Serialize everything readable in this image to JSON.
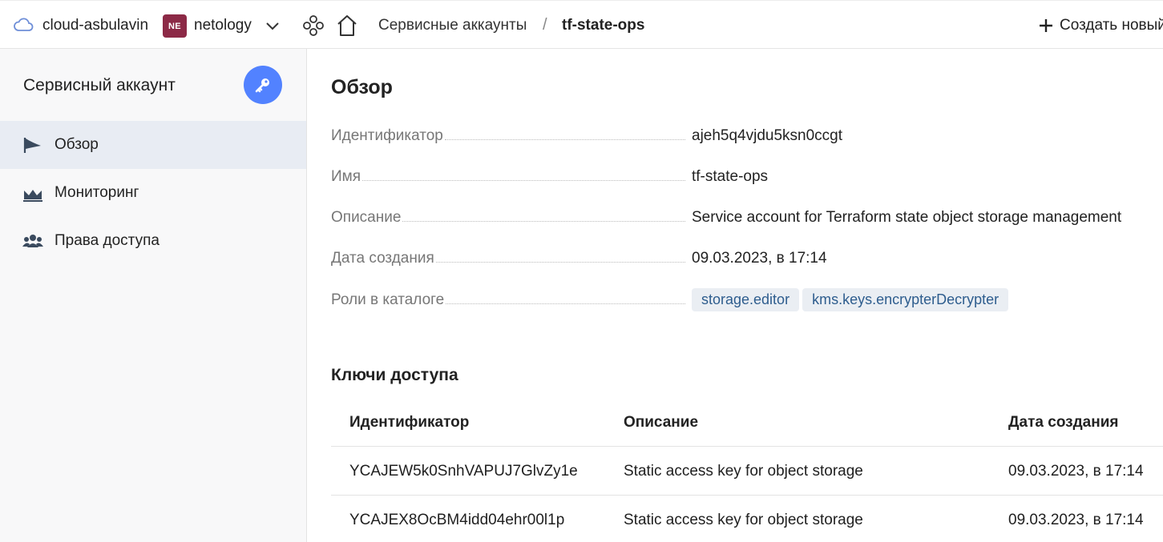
{
  "topbar": {
    "cloud_name": "cloud-asbulavin",
    "folder_badge": "NE",
    "folder_name": "netology",
    "breadcrumb_section": "Сервисные аккаунты",
    "breadcrumb_separator": "/",
    "breadcrumb_current": "tf-state-ops",
    "create_label": "Создать новый"
  },
  "sidebar": {
    "title": "Сервисный аккаунт",
    "items": [
      {
        "label": "Обзор",
        "icon": "flag-icon",
        "active": true
      },
      {
        "label": "Мониторинг",
        "icon": "area-chart-icon",
        "active": false
      },
      {
        "label": "Права доступа",
        "icon": "users-icon",
        "active": false
      }
    ]
  },
  "overview": {
    "heading": "Обзор",
    "properties": [
      {
        "key": "Идентификатор",
        "value": "ajeh5q4vjdu5ksn0ccgt"
      },
      {
        "key": "Имя",
        "value": "tf-state-ops"
      },
      {
        "key": "Описание",
        "value": "Service account for Terraform state object storage management"
      },
      {
        "key": "Дата создания",
        "value": "09.03.2023, в 17:14"
      },
      {
        "key": "Роли в каталоге",
        "roles": [
          "storage.editor",
          "kms.keys.encrypterDecrypter"
        ]
      }
    ]
  },
  "access_keys": {
    "heading": "Ключи доступа",
    "columns": [
      "Идентификатор",
      "Описание",
      "Дата создания"
    ],
    "rows": [
      [
        "YCAJEW5k0SnhVAPUJ7GlvZy1e",
        "Static access key for object storage",
        "09.03.2023, в 17:14"
      ],
      [
        "YCAJEX8OcBM4idd04ehr00l1p",
        "Static access key for object storage",
        "09.03.2023, в 17:14"
      ]
    ]
  },
  "colors": {
    "accent": "#5282ff",
    "folder_badge": "#8c2946",
    "chip_bg": "#eaeef3",
    "chip_text": "#2e5d8e",
    "sidebar_active": "#e8ecf3"
  }
}
